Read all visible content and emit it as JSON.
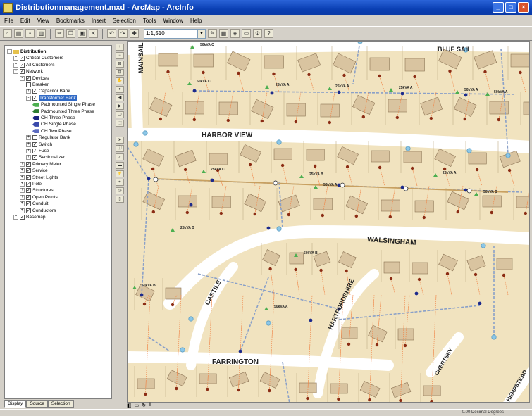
{
  "window": {
    "title": "Distributionmanagement.mxd - ArcMap - ArcInfo",
    "buttons": [
      "_",
      "□",
      "×"
    ]
  },
  "menu": [
    "File",
    "Edit",
    "View",
    "Bookmarks",
    "Insert",
    "Selection",
    "Tools",
    "Window",
    "Help"
  ],
  "toolbar": {
    "scale": "1:1,510"
  },
  "toc": {
    "items": [
      {
        "label": "Distribution",
        "level": 0,
        "expand": "-",
        "check": false,
        "bold": true
      },
      {
        "label": "Critical Customers",
        "level": 1,
        "expand": "+",
        "check": true
      },
      {
        "label": "All Customers",
        "level": 1,
        "expand": "+",
        "check": true
      },
      {
        "label": "Network",
        "level": 1,
        "expand": "-",
        "check": true
      },
      {
        "label": "Devices",
        "level": 2,
        "expand": "-",
        "check": true
      },
      {
        "label": "Breaker",
        "level": 3,
        "expand": "",
        "check": false
      },
      {
        "label": "Capacitor Bank",
        "level": 3,
        "expand": "+",
        "check": true
      },
      {
        "label": "Transformer Bank",
        "level": 3,
        "expand": "-",
        "check": true,
        "selected": true
      },
      {
        "label": "Padmounted Single Phase",
        "level": 4,
        "symbol": "pad1"
      },
      {
        "label": "Padmounted Three Phase",
        "level": 4,
        "symbol": "pad3"
      },
      {
        "label": "OH Three Phase",
        "level": 4,
        "symbol": "oh3"
      },
      {
        "label": "OH Single Phase",
        "level": 4,
        "symbol": "oh1"
      },
      {
        "label": "OH Two Phase",
        "level": 4,
        "symbol": "oh2"
      },
      {
        "label": "Regulator Bank",
        "level": 3,
        "expand": "+",
        "check": false
      },
      {
        "label": "Switch",
        "level": 3,
        "expand": "+",
        "check": true
      },
      {
        "label": "Fuse",
        "level": 3,
        "expand": "+",
        "check": true
      },
      {
        "label": "Sectionalizer",
        "level": 3,
        "expand": "+",
        "check": true
      },
      {
        "label": "Primary Meter",
        "level": 2,
        "expand": "+",
        "check": true
      },
      {
        "label": "Service",
        "level": 2,
        "expand": "+",
        "check": true
      },
      {
        "label": "Street Lights",
        "level": 2,
        "expand": "+",
        "check": true
      },
      {
        "label": "Pole",
        "level": 2,
        "expand": "+",
        "check": true
      },
      {
        "label": "Structures",
        "level": 2,
        "expand": "+",
        "check": true
      },
      {
        "label": "Open Points",
        "level": 2,
        "expand": "+",
        "check": true
      },
      {
        "label": "Conduit",
        "level": 2,
        "expand": "+",
        "check": true
      },
      {
        "label": "Conductors",
        "level": 2,
        "expand": "+",
        "check": true
      },
      {
        "label": "Basemap",
        "level": 1,
        "expand": "+",
        "check": true
      }
    ],
    "tabs": [
      "Display",
      "Source",
      "Selection"
    ]
  },
  "map": {
    "streets": [
      "MAINSAIL",
      "BLUE SAIL",
      "HARBOR VIEW",
      "WALSINGHAM",
      "CASTILE",
      "HARTFORDSHIRE",
      "FARRINGTON",
      "CHERTSEY",
      "HEMPSTEAD"
    ],
    "callouts": [
      "50kVA C",
      "50kVA C",
      "25kVA A",
      "25kVA A",
      "25kVA A",
      "50kVA A",
      "50kVA A",
      "25kVA C",
      "25kVA B",
      "50kVA A",
      "25kVA A",
      "50kVA B",
      "25kVA B",
      "50kVA B",
      "50kVA B",
      "50kVA A"
    ],
    "colors": {
      "background": "#f1e3bf",
      "road": "#ffffff",
      "building": "#d9c4a0",
      "primary_line": "#8aa0c8",
      "service_line": "#f0874a",
      "tap_line": "#c08a5a"
    }
  },
  "status": {
    "coords": "0.00  Decimal Degrees"
  }
}
